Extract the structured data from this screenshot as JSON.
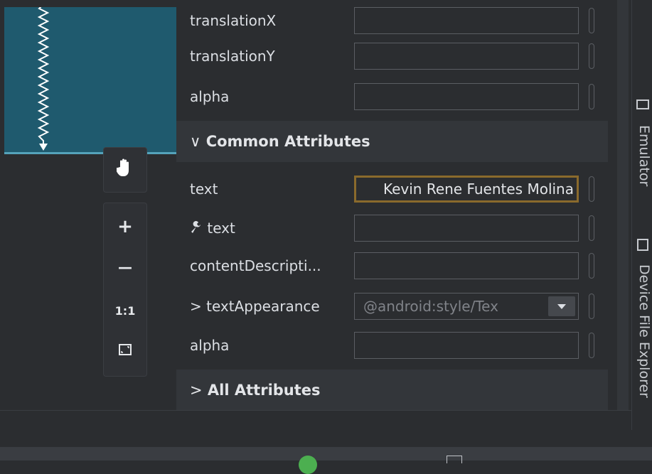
{
  "canvas": {
    "background": "#1f5a6e"
  },
  "toolbar": {
    "pan_icon": "hand-icon",
    "zoom_in_label": "+",
    "zoom_out_label": "—",
    "actual_size_label": "1:1",
    "fit_icon": "fit-screen-icon"
  },
  "attributes": {
    "rows_top": [
      {
        "label": "translationX",
        "value": ""
      },
      {
        "label": "translationY",
        "value": ""
      },
      {
        "label": "alpha",
        "value": ""
      }
    ],
    "common_section": "Common Attributes",
    "common_rows": {
      "text_label": "text",
      "text_value": "Kevin Rene Fuentes Molina",
      "tools_text_label": "text",
      "content_desc_label": "contentDescripti...",
      "text_appearance_label": "textAppearance",
      "text_appearance_value": "@android:style/Tex",
      "alpha_label": "alpha"
    },
    "all_section": "All Attributes"
  },
  "right_sidebar": {
    "emulator": "Emulator",
    "device_file_explorer": "Device File Explorer"
  },
  "colors": {
    "focus_border": "#8a6a2c",
    "status_dot": "#4caf50"
  }
}
